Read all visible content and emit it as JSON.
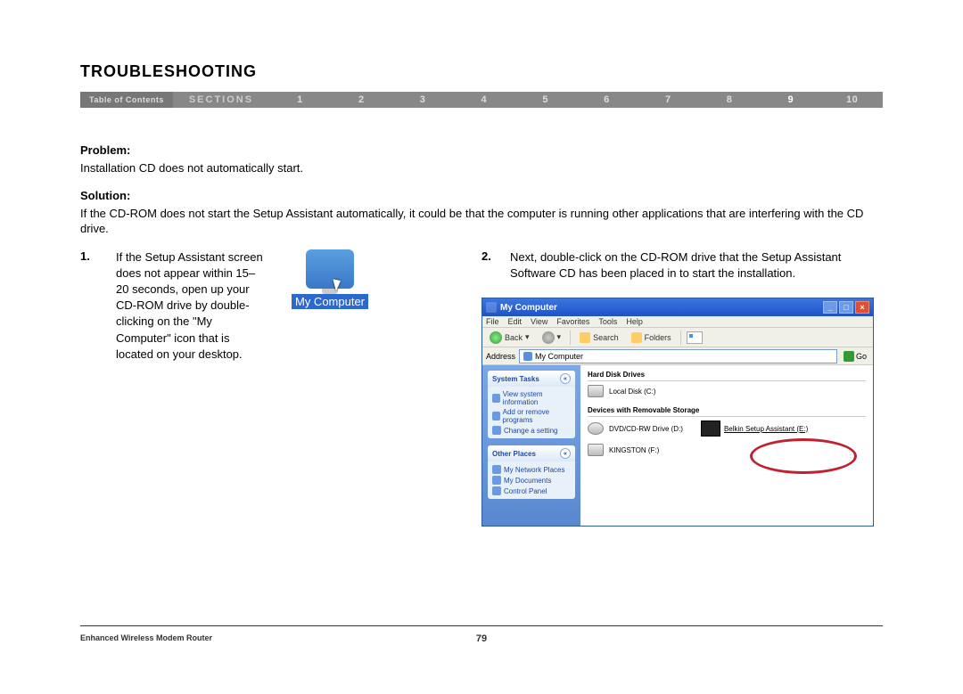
{
  "title": "TROUBLESHOOTING",
  "nav": {
    "toc": "Table of Contents",
    "sections": "SECTIONS",
    "nums": [
      "1",
      "2",
      "3",
      "4",
      "5",
      "6",
      "7",
      "8",
      "9",
      "10"
    ],
    "active": "9"
  },
  "problem_label": "Problem:",
  "problem_text": "Installation CD does not automatically start.",
  "solution_label": "Solution:",
  "solution_text": "If the CD-ROM does not start the Setup Assistant automatically, it could be that the computer is running other applications that are interfering with the CD drive.",
  "step1": {
    "num": "1.",
    "text": "If the Setup Assistant screen does not appear within 15–20 seconds, open up your CD-ROM drive by double-clicking on the \"My Computer\" icon that is located on your desktop."
  },
  "mycomputer_label": "My Computer",
  "step2": {
    "num": "2.",
    "text": "Next, double-click on the CD-ROM drive that the Setup Assistant Software CD has been placed in to start the installation."
  },
  "xp": {
    "title": "My Computer",
    "menu": [
      "File",
      "Edit",
      "View",
      "Favorites",
      "Tools",
      "Help"
    ],
    "back": "Back",
    "search": "Search",
    "folders": "Folders",
    "addr_label": "Address",
    "addr_value": "My Computer",
    "go": "Go",
    "side": {
      "system_tasks": "System Tasks",
      "system_links": [
        "View system information",
        "Add or remove programs",
        "Change a setting"
      ],
      "other_places": "Other Places",
      "other_links": [
        "My Network Places",
        "My Documents",
        "Control Panel"
      ]
    },
    "cat1": "Hard Disk Drives",
    "drive1": "Local Disk (C:)",
    "cat2": "Devices with Removable Storage",
    "drive2": "DVD/CD-RW Drive (D:)",
    "drive3": "KINGSTON (F:)",
    "drive_hi": "Belkin Setup Assistant (E:)"
  },
  "footer": {
    "left": "Enhanced Wireless Modem Router",
    "page": "79"
  }
}
